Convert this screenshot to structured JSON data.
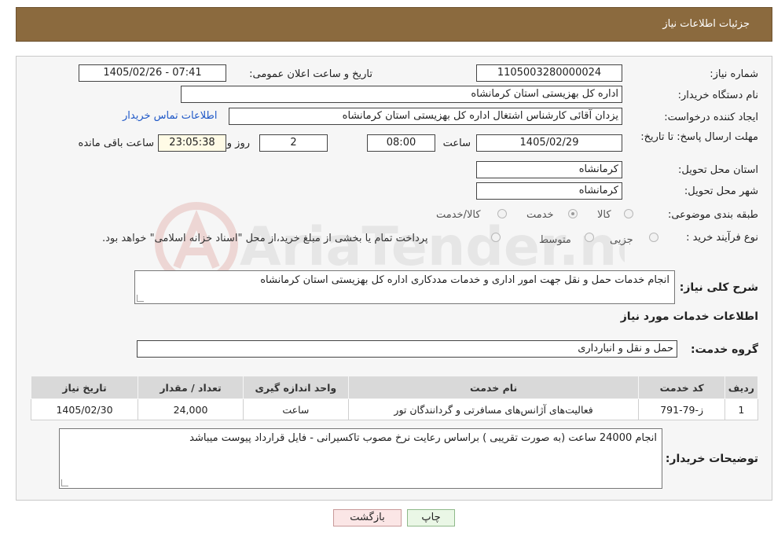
{
  "header": {
    "title": "جزئیات اطلاعات نیاز"
  },
  "form": {
    "need_number_label": "شماره نیاز:",
    "need_number": "1105003280000024",
    "announce_label": "تاریخ و ساعت اعلان عمومی:",
    "announce_value": "1405/02/26 - 07:41",
    "buyer_org_label": "نام دستگاه خریدار:",
    "buyer_org": "اداره کل بهزیستی استان کرمانشاه",
    "creator_label": "ایجاد کننده درخواست:",
    "creator": "یزدان آقائی کارشناس اشتغال  اداره کل بهزیستی استان کرمانشاه",
    "contact_link": "اطلاعات تماس خریدار",
    "deadline_label": "مهلت ارسال پاسخ: تا تاریخ:",
    "deadline_date": "1405/02/29",
    "time_label": "ساعت",
    "deadline_time": "08:00",
    "days_value": "2",
    "days_label": "روز و",
    "remaining_time": "23:05:38",
    "remaining_label": "ساعت باقی مانده",
    "province_label": "استان محل تحویل:",
    "province": "کرمانشاه",
    "city_label": "شهر محل تحویل:",
    "city": "کرمانشاه",
    "category_label": "طبقه بندی موضوعی:",
    "category_options": [
      "کالا",
      "خدمت",
      "کالا/خدمت"
    ],
    "category_selected": "خدمت",
    "purchase_type_label": "نوع فرآیند خرید :",
    "purchase_options": [
      "جزیی",
      "متوسط"
    ],
    "purchase_selected": "",
    "purchase_note": "پرداخت تمام یا بخشی از مبلغ خرید،از محل \"اسناد خزانه اسلامی\" خواهد بود.",
    "summary_label": "شرح کلی نیاز:",
    "summary": "انجام خدمات حمل و نقل جهت امور اداری و خدمات مددکاری اداره کل بهزیستی استان کرمانشاه",
    "services_section_title": "اطلاعات خدمات مورد نیاز",
    "service_group_label": "گروه خدمت:",
    "service_group": "حمل و نقل و انبارداری"
  },
  "table": {
    "headers": [
      "ردیف",
      "کد خدمت",
      "نام خدمت",
      "واحد اندازه گیری",
      "تعداد / مقدار",
      "تاریخ نیاز"
    ],
    "rows": [
      [
        "1",
        "ز-79-791",
        "فعالیت‌های آژانس‌های مسافرتی و گردانندگان تور",
        "ساعت",
        "24,000",
        "1405/02/30"
      ]
    ]
  },
  "buyer_notes_label": "توضیحات خریدار:",
  "buyer_notes": "انجام 24000 ساعت (به صورت تقریبی ) براساس رعایت نرخ مصوب تاکسیرانی - فایل قرارداد پیوست میباشد",
  "buttons": {
    "print": "چاپ",
    "back": "بازگشت"
  },
  "colors": {
    "header_bg": "#8b6a3e",
    "panel_bg": "#f6f6f6",
    "link": "#1f58c7",
    "print_btn_bg": "#eaf7e6",
    "back_btn_bg": "#fbe6e6"
  },
  "watermark_text": "AriaTender.neT"
}
